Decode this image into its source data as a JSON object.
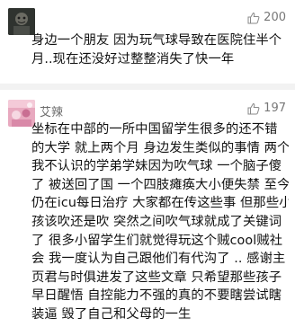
{
  "comments": [
    {
      "likes": "200",
      "text_lines": [
        "身边一个朋友 因为玩气球导致在医院住半个",
        "月..现在还没好过整整消失了快一年"
      ]
    },
    {
      "username": "艾辣",
      "likes": "197",
      "text_lines": [
        "坐标在中部的一所中国留学生很多的还不错",
        "的大学 就上两个月 身边发生类似的事情 两个",
        "我不认识的学弟学妹因为吹气球 一个脑子傻",
        "了 被送回了国 一个四肢瘫痪大小便失禁 至今",
        "仍在icu每日治疗 大家都在传这些事 但那些小",
        "孩该吹还是吹 突然之间吹气球就成了关键词",
        "了 很多小留学生们就觉得玩这个贼cool贼社",
        "会 我一度认为自己跟他们有代沟了 .. 感谢主",
        "页君与时俱进发了这些文章 只希望那些孩子",
        "早日醒悟 自控能力不强的真的不要瞎尝试瞎",
        "装逼 毁了自己和父母的一生"
      ]
    }
  ]
}
